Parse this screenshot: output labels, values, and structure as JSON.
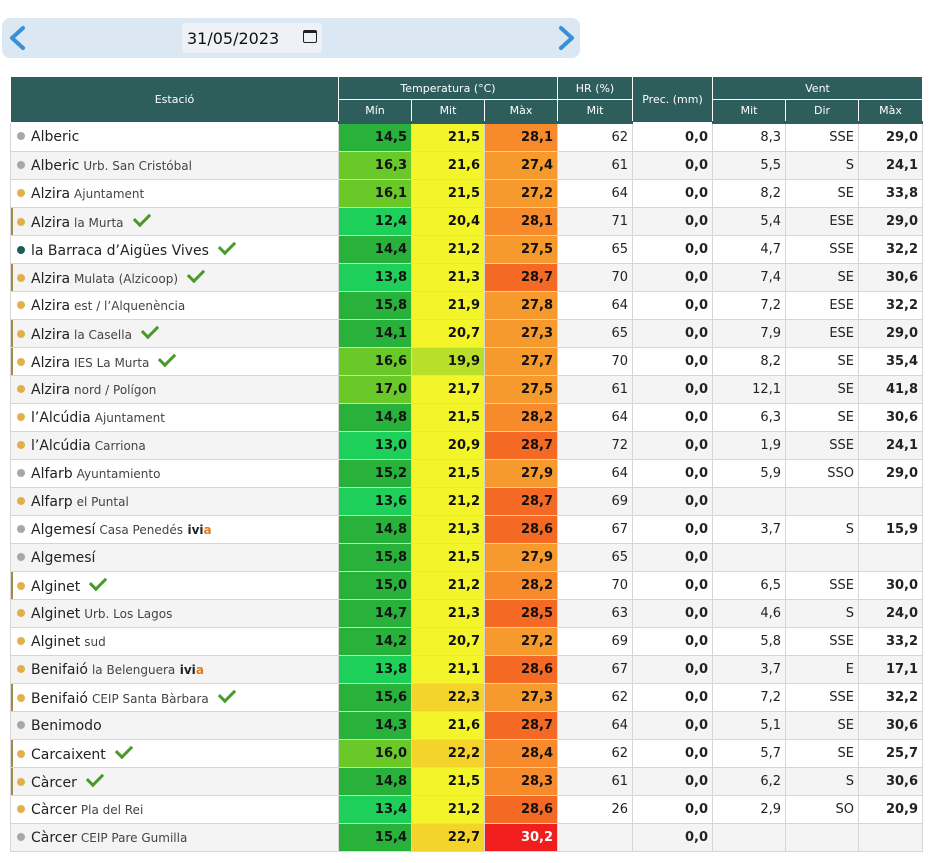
{
  "date_picker": {
    "value": "31/05/2023",
    "prev_icon": "chevron-left-icon",
    "next_icon": "chevron-right-icon",
    "calendar_icon": "calendar-icon"
  },
  "colors": {
    "header_bg": "#2e5e5c",
    "arrow": "#3a8fd6",
    "check": "#4a9a2a",
    "dot_gray": "#a8a8a8",
    "dot_gold": "#e2b04a",
    "dot_teal": "#1f5c5a"
  },
  "table": {
    "headers": {
      "station": "Estació",
      "temperature": "Temperatura (°C)",
      "hr": "HR (%)",
      "prec": "Prec. (mm)",
      "wind": "Vent",
      "min": "Mín",
      "mit": "Mit",
      "max": "Màx",
      "hr_mit": "Mit",
      "wind_mit": "Mit",
      "wind_dir": "Dir",
      "wind_max": "Màx"
    },
    "rows": [
      {
        "name": "Alberic",
        "sub": "",
        "dot": "gray",
        "check": false,
        "ivia": false,
        "bar": false,
        "tmin": "14,5",
        "tmit": "21,5",
        "tmax": "28,1",
        "hr": "62",
        "prec": "0,0",
        "wmit": "8,3",
        "wdir": "SSE",
        "wmax": "29,0",
        "cmin": "#28b23c",
        "cmit": "#f4f42a",
        "cmax": "#f78a2a"
      },
      {
        "name": "Alberic",
        "sub": "Urb. San Cristóbal",
        "dot": "gray",
        "check": false,
        "ivia": false,
        "bar": false,
        "tmin": "16,3",
        "tmit": "21,6",
        "tmax": "27,4",
        "hr": "61",
        "prec": "0,0",
        "wmit": "5,5",
        "wdir": "S",
        "wmax": "24,1",
        "cmin": "#6ac829",
        "cmit": "#f4f42a",
        "cmax": "#f79a2e"
      },
      {
        "name": "Alzira",
        "sub": "Ajuntament",
        "dot": "gold",
        "check": false,
        "ivia": false,
        "bar": false,
        "tmin": "16,1",
        "tmit": "21,5",
        "tmax": "27,2",
        "hr": "64",
        "prec": "0,0",
        "wmit": "8,2",
        "wdir": "SE",
        "wmax": "33,8",
        "cmin": "#6ac829",
        "cmit": "#f4f42a",
        "cmax": "#f79a2e"
      },
      {
        "name": "Alzira",
        "sub": "la Murta",
        "dot": "gold",
        "check": true,
        "ivia": false,
        "bar": true,
        "tmin": "12,4",
        "tmit": "20,4",
        "tmax": "28,1",
        "hr": "71",
        "prec": "0,0",
        "wmit": "5,4",
        "wdir": "ESE",
        "wmax": "29,0",
        "cmin": "#1ed05a",
        "cmit": "#f4f42a",
        "cmax": "#f78a2a"
      },
      {
        "name": "la Barraca d’Aigües Vives",
        "sub": "",
        "dot": "teal",
        "check": true,
        "ivia": false,
        "bar": false,
        "tmin": "14,4",
        "tmit": "21,2",
        "tmax": "27,5",
        "hr": "65",
        "prec": "0,0",
        "wmit": "4,7",
        "wdir": "SSE",
        "wmax": "32,2",
        "cmin": "#28b23c",
        "cmit": "#f4f42a",
        "cmax": "#f79a2e"
      },
      {
        "name": "Alzira",
        "sub": "Mulata (Alzicoop)",
        "dot": "gold",
        "check": true,
        "ivia": false,
        "bar": true,
        "tmin": "13,8",
        "tmit": "21,3",
        "tmax": "28,7",
        "hr": "70",
        "prec": "0,0",
        "wmit": "7,4",
        "wdir": "SE",
        "wmax": "30,6",
        "cmin": "#1ed05a",
        "cmit": "#f4f42a",
        "cmax": "#f46a24"
      },
      {
        "name": "Alzira",
        "sub": "est / l’Alquenència",
        "dot": "gold",
        "check": false,
        "ivia": false,
        "bar": false,
        "tmin": "15,8",
        "tmit": "21,9",
        "tmax": "27,8",
        "hr": "64",
        "prec": "0,0",
        "wmit": "7,2",
        "wdir": "ESE",
        "wmax": "32,2",
        "cmin": "#28b23c",
        "cmit": "#f4f42a",
        "cmax": "#f79a2e"
      },
      {
        "name": "Alzira",
        "sub": "la Casella",
        "dot": "gold",
        "check": true,
        "ivia": false,
        "bar": true,
        "tmin": "14,1",
        "tmit": "20,7",
        "tmax": "27,3",
        "hr": "65",
        "prec": "0,0",
        "wmit": "7,9",
        "wdir": "ESE",
        "wmax": "29,0",
        "cmin": "#28b23c",
        "cmit": "#f4f42a",
        "cmax": "#f79a2e"
      },
      {
        "name": "Alzira",
        "sub": "IES La Murta",
        "dot": "gold",
        "check": true,
        "ivia": false,
        "bar": true,
        "tmin": "16,6",
        "tmit": "19,9",
        "tmax": "27,7",
        "hr": "70",
        "prec": "0,0",
        "wmit": "8,2",
        "wdir": "SE",
        "wmax": "35,4",
        "cmin": "#6ac829",
        "cmit": "#b8e02a",
        "cmax": "#f79a2e"
      },
      {
        "name": "Alzira",
        "sub": "nord / Polígon",
        "dot": "gold",
        "check": false,
        "ivia": false,
        "bar": false,
        "tmin": "17,0",
        "tmit": "21,7",
        "tmax": "27,5",
        "hr": "61",
        "prec": "0,0",
        "wmit": "12,1",
        "wdir": "SE",
        "wmax": "41,8",
        "cmin": "#6ac829",
        "cmit": "#f4f42a",
        "cmax": "#f79a2e"
      },
      {
        "name": "l’Alcúdia",
        "sub": "Ajuntament",
        "dot": "gold",
        "check": false,
        "ivia": false,
        "bar": false,
        "tmin": "14,8",
        "tmit": "21,5",
        "tmax": "28,2",
        "hr": "64",
        "prec": "0,0",
        "wmit": "6,3",
        "wdir": "SE",
        "wmax": "30,6",
        "cmin": "#28b23c",
        "cmit": "#f4f42a",
        "cmax": "#f78a2a"
      },
      {
        "name": "l’Alcúdia",
        "sub": "Carriona",
        "dot": "gold",
        "check": false,
        "ivia": false,
        "bar": false,
        "tmin": "13,0",
        "tmit": "20,9",
        "tmax": "28,7",
        "hr": "72",
        "prec": "0,0",
        "wmit": "1,9",
        "wdir": "SSE",
        "wmax": "24,1",
        "cmin": "#1ed05a",
        "cmit": "#f4f42a",
        "cmax": "#f46a24"
      },
      {
        "name": "Alfarb",
        "sub": "Ayuntamiento",
        "dot": "gray",
        "check": false,
        "ivia": false,
        "bar": false,
        "tmin": "15,2",
        "tmit": "21,5",
        "tmax": "27,9",
        "hr": "64",
        "prec": "0,0",
        "wmit": "5,9",
        "wdir": "SSO",
        "wmax": "29,0",
        "cmin": "#28b23c",
        "cmit": "#f4f42a",
        "cmax": "#f79a2e"
      },
      {
        "name": "Alfarp",
        "sub": "el Puntal",
        "dot": "gold",
        "check": false,
        "ivia": false,
        "bar": false,
        "tmin": "13,6",
        "tmit": "21,2",
        "tmax": "28,7",
        "hr": "69",
        "prec": "0,0",
        "wmit": "",
        "wdir": "",
        "wmax": "",
        "cmin": "#1ed05a",
        "cmit": "#f4f42a",
        "cmax": "#f46a24"
      },
      {
        "name": "Algemesí",
        "sub": "Casa Penedés",
        "dot": "gray",
        "check": false,
        "ivia": true,
        "bar": false,
        "tmin": "14,8",
        "tmit": "21,3",
        "tmax": "28,6",
        "hr": "67",
        "prec": "0,0",
        "wmit": "3,7",
        "wdir": "S",
        "wmax": "15,9",
        "cmin": "#28b23c",
        "cmit": "#f4f42a",
        "cmax": "#f46a24"
      },
      {
        "name": "Algemesí",
        "sub": "",
        "dot": "gray",
        "check": false,
        "ivia": false,
        "bar": false,
        "tmin": "15,8",
        "tmit": "21,5",
        "tmax": "27,9",
        "hr": "65",
        "prec": "0,0",
        "wmit": "",
        "wdir": "",
        "wmax": "",
        "cmin": "#28b23c",
        "cmit": "#f4f42a",
        "cmax": "#f79a2e"
      },
      {
        "name": "Alginet",
        "sub": "",
        "dot": "gold",
        "check": true,
        "ivia": false,
        "bar": true,
        "tmin": "15,0",
        "tmit": "21,2",
        "tmax": "28,2",
        "hr": "70",
        "prec": "0,0",
        "wmit": "6,5",
        "wdir": "SSE",
        "wmax": "30,0",
        "cmin": "#28b23c",
        "cmit": "#f4f42a",
        "cmax": "#f78a2a"
      },
      {
        "name": "Alginet",
        "sub": "Urb. Los Lagos",
        "dot": "gold",
        "check": false,
        "ivia": false,
        "bar": false,
        "tmin": "14,7",
        "tmit": "21,3",
        "tmax": "28,5",
        "hr": "63",
        "prec": "0,0",
        "wmit": "4,6",
        "wdir": "S",
        "wmax": "24,0",
        "cmin": "#28b23c",
        "cmit": "#f4f42a",
        "cmax": "#f46a24"
      },
      {
        "name": "Alginet",
        "sub": "sud",
        "dot": "gold",
        "check": false,
        "ivia": false,
        "bar": false,
        "tmin": "14,2",
        "tmit": "20,7",
        "tmax": "27,2",
        "hr": "69",
        "prec": "0,0",
        "wmit": "5,8",
        "wdir": "SSE",
        "wmax": "33,2",
        "cmin": "#28b23c",
        "cmit": "#f4f42a",
        "cmax": "#f79a2e"
      },
      {
        "name": "Benifaió",
        "sub": "la Belenguera",
        "dot": "gold",
        "check": false,
        "ivia": true,
        "bar": false,
        "tmin": "13,8",
        "tmit": "21,1",
        "tmax": "28,6",
        "hr": "67",
        "prec": "0,0",
        "wmit": "3,7",
        "wdir": "E",
        "wmax": "17,1",
        "cmin": "#1ed05a",
        "cmit": "#f4f42a",
        "cmax": "#f46a24"
      },
      {
        "name": "Benifaió",
        "sub": "CEIP Santa Bàrbara",
        "dot": "gold",
        "check": true,
        "ivia": false,
        "bar": true,
        "tmin": "15,6",
        "tmit": "22,3",
        "tmax": "27,3",
        "hr": "62",
        "prec": "0,0",
        "wmit": "7,2",
        "wdir": "SSE",
        "wmax": "32,2",
        "cmin": "#28b23c",
        "cmit": "#f4d42a",
        "cmax": "#f79a2e"
      },
      {
        "name": "Benimodo",
        "sub": "",
        "dot": "gray",
        "check": false,
        "ivia": false,
        "bar": false,
        "tmin": "14,3",
        "tmit": "21,6",
        "tmax": "28,7",
        "hr": "64",
        "prec": "0,0",
        "wmit": "5,1",
        "wdir": "SE",
        "wmax": "30,6",
        "cmin": "#28b23c",
        "cmit": "#f4f42a",
        "cmax": "#f46a24"
      },
      {
        "name": "Carcaixent",
        "sub": "",
        "dot": "gold",
        "check": true,
        "ivia": false,
        "bar": true,
        "tmin": "16,0",
        "tmit": "22,2",
        "tmax": "28,4",
        "hr": "62",
        "prec": "0,0",
        "wmit": "5,7",
        "wdir": "SE",
        "wmax": "25,7",
        "cmin": "#6ac829",
        "cmit": "#f4d42a",
        "cmax": "#f78a2a"
      },
      {
        "name": "Càrcer",
        "sub": "",
        "dot": "gold",
        "check": true,
        "ivia": false,
        "bar": true,
        "tmin": "14,8",
        "tmit": "21,5",
        "tmax": "28,3",
        "hr": "61",
        "prec": "0,0",
        "wmit": "6,2",
        "wdir": "S",
        "wmax": "30,6",
        "cmin": "#28b23c",
        "cmit": "#f4f42a",
        "cmax": "#f78a2a"
      },
      {
        "name": "Càrcer",
        "sub": "Pla del Rei",
        "dot": "gold",
        "check": false,
        "ivia": false,
        "bar": false,
        "tmin": "13,4",
        "tmit": "21,2",
        "tmax": "28,6",
        "hr": "26",
        "prec": "0,0",
        "wmit": "2,9",
        "wdir": "SO",
        "wmax": "20,9",
        "cmin": "#1ed05a",
        "cmit": "#f4f42a",
        "cmax": "#f46a24"
      },
      {
        "name": "Càrcer",
        "sub": "CEIP Pare Gumilla",
        "dot": "gray",
        "check": false,
        "ivia": false,
        "bar": false,
        "tmin": "15,4",
        "tmit": "22,7",
        "tmax": "30,2",
        "hr": "",
        "prec": "0,0",
        "wmit": "",
        "wdir": "",
        "wmax": "",
        "cmin": "#28b23c",
        "cmit": "#f4d42a",
        "cmax": "#f01e1e"
      }
    ],
    "ivia_label_i": "ivi",
    "ivia_label_a": "a"
  }
}
